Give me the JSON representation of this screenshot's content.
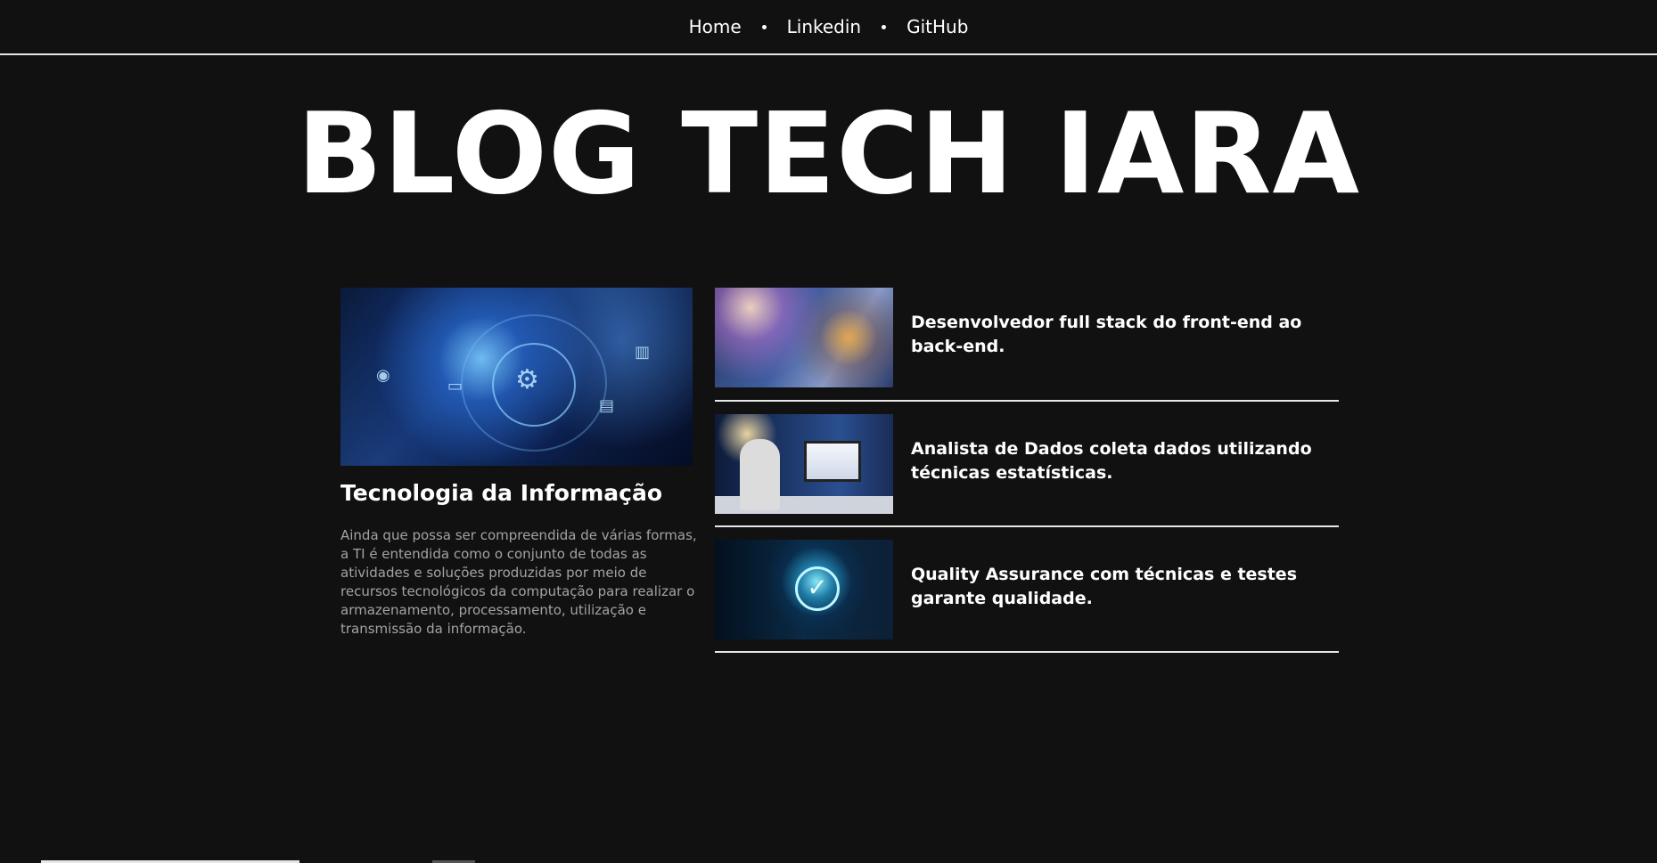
{
  "nav": {
    "items": [
      {
        "label": "Home"
      },
      {
        "label": "Linkedin"
      },
      {
        "label": "GitHub"
      }
    ]
  },
  "hero": {
    "title": "BLOG TECH IARA"
  },
  "featured": {
    "title": "Tecnologia da Informação",
    "description": "Ainda que possa ser compreendida de várias formas, a TI é entendida como o conjunto de todas as atividades e soluções produzidas por meio de recursos tecnológicos da computação para realizar o armazenamento, processamento, utilização e transmissão da informação."
  },
  "articles": [
    {
      "title": "Desenvolvedor full stack do front-end ao back-end."
    },
    {
      "title": "Analista de Dados coleta dados utilizando técnicas estatísticas."
    },
    {
      "title": "Quality Assurance com técnicas e testes garante qualidade."
    }
  ],
  "colors": {
    "background": "#111111",
    "text": "#ffffff",
    "muted_text": "#a3a3a3",
    "divider": "#e8e8e8"
  }
}
